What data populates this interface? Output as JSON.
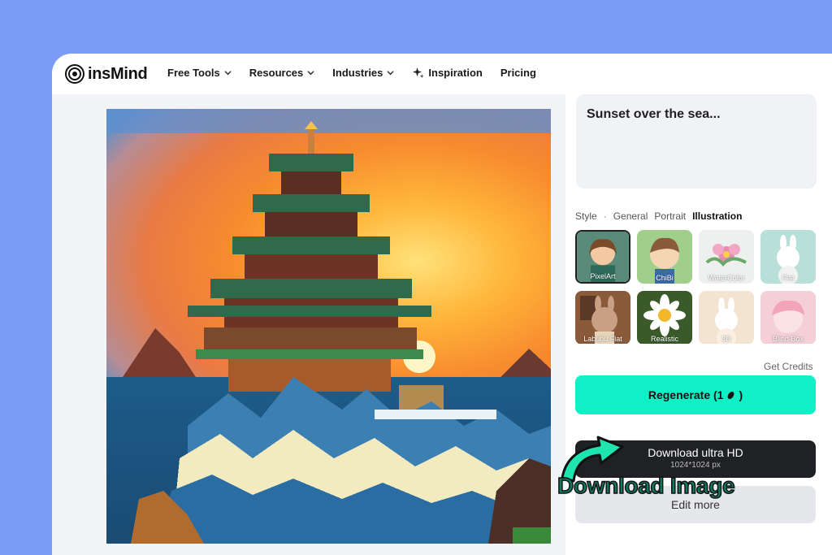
{
  "brand": {
    "name": "insMind"
  },
  "nav": {
    "items": [
      {
        "label": "Free Tools",
        "dropdown": true
      },
      {
        "label": "Resources",
        "dropdown": true
      },
      {
        "label": "Industries",
        "dropdown": true
      },
      {
        "label": "Inspiration",
        "icon": "sparkle-icon"
      },
      {
        "label": "Pricing"
      }
    ]
  },
  "prompt": {
    "text": "Sunset over the sea..."
  },
  "style": {
    "label": "Style",
    "separator": "·",
    "tabs": [
      "General",
      "Portrait",
      "Illustration"
    ],
    "active_tab": "Illustration",
    "thumbnails": [
      {
        "label": "PixelArt",
        "selected": true
      },
      {
        "label": "ChiBi"
      },
      {
        "label": "WaterColor"
      },
      {
        "label": "Flat"
      },
      {
        "label": "Labubu Flat"
      },
      {
        "label": "Realistic"
      },
      {
        "label": "3D"
      },
      {
        "label": "Blind Box"
      }
    ]
  },
  "credits": {
    "label": "Get Credits"
  },
  "actions": {
    "regenerate_label": "Regenerate (1",
    "regenerate_suffix": ")",
    "download_label": "Download ultra HD",
    "download_size": "1024*1024 px",
    "edit_label": "Edit more"
  },
  "callout": {
    "text": "Download Image"
  },
  "colors": {
    "background": "#7b9cf4",
    "accent": "#10f0c6",
    "dark_button": "#1f2124",
    "callout": "#1ee5b0"
  }
}
